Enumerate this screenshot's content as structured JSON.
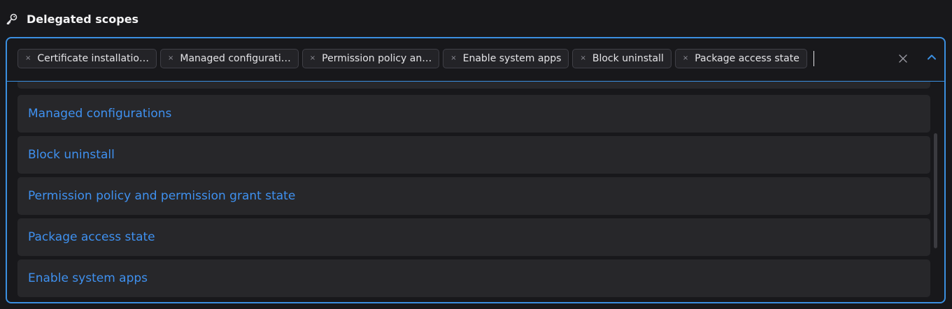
{
  "header": {
    "title": "Delegated scopes",
    "icon": "key-icon"
  },
  "selected_chips": [
    {
      "label": "Certificate installatio…"
    },
    {
      "label": "Managed configurati…"
    },
    {
      "label": "Permission policy an…"
    },
    {
      "label": "Enable system apps"
    },
    {
      "label": "Block uninstall"
    },
    {
      "label": "Package access state"
    }
  ],
  "chip_remove_glyph": "×",
  "options": [
    {
      "label": "Managed configurations"
    },
    {
      "label": "Block uninstall"
    },
    {
      "label": "Permission policy and permission grant state"
    },
    {
      "label": "Package access state"
    },
    {
      "label": "Enable system apps"
    }
  ],
  "colors": {
    "background": "#18181b",
    "accent": "#3b8fe0",
    "option_text": "#3f91f0",
    "option_bg": "#27272a",
    "chip_bg": "#232327"
  }
}
